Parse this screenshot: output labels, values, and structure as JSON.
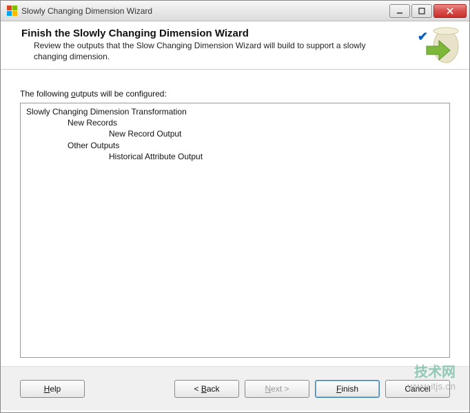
{
  "window": {
    "title": "Slowly Changing Dimension Wizard"
  },
  "header": {
    "title": "Finish the Slowly Changing Dimension Wizard",
    "subtitle": "Review the outputs that the Slow Changing Dimension Wizard will build to support a slowly changing dimension."
  },
  "body": {
    "label_pre": "The following ",
    "label_accel": "o",
    "label_post": "utputs will be configured:",
    "tree": {
      "root": "Slowly Changing Dimension Transformation",
      "group1": "New Records",
      "group1_item": "New Record Output",
      "group2": "Other Outputs",
      "group2_item": "Historical Attribute Output"
    }
  },
  "buttons": {
    "help_accel": "H",
    "help_post": "elp",
    "back_pre": "< ",
    "back_accel": "B",
    "back_post": "ack",
    "next_accel": "N",
    "next_post": "ext >",
    "finish_accel": "F",
    "finish_post": "inish",
    "cancel": "Cancel"
  },
  "watermark": {
    "line1": "技术网",
    "line2": "www.itjs.cn"
  }
}
